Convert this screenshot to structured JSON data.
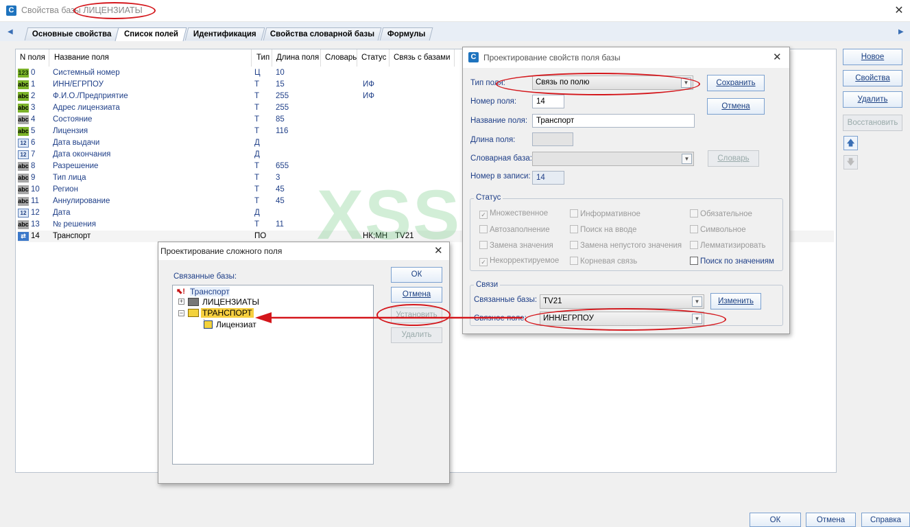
{
  "window": {
    "title": "Свойства базы ЛИЦЕНЗИАТЫ",
    "close": "✕"
  },
  "tabs": [
    {
      "label": "Основные свойства",
      "active": false
    },
    {
      "label": "Список полей",
      "active": true
    },
    {
      "label": "Идентификация",
      "active": false
    },
    {
      "label": "Свойства словарной базы",
      "active": false
    },
    {
      "label": "Формулы",
      "active": false
    }
  ],
  "table": {
    "headers": [
      "N поля",
      "Название поля",
      "Тип",
      "Длина поля",
      "Словарь",
      "Статус",
      "Связь с базами"
    ],
    "rows": [
      {
        "icon": "123",
        "num": "0",
        "name": "Системный номер",
        "type": "Ц",
        "len": "10",
        "status": "",
        "link": ""
      },
      {
        "icon": "abc",
        "num": "1",
        "name": "ИНН/ЕГРПОУ",
        "type": "Т",
        "len": "15",
        "status": "ИФ",
        "link": ""
      },
      {
        "icon": "abc",
        "num": "2",
        "name": "Ф.И.О./Предприятие",
        "type": "Т",
        "len": "255",
        "status": "ИФ",
        "link": ""
      },
      {
        "icon": "abc",
        "num": "3",
        "name": "Адрес лицензиата",
        "type": "Т",
        "len": "255",
        "status": "",
        "link": ""
      },
      {
        "icon": "abc",
        "num": "4",
        "name": "Состояние",
        "type": "Т",
        "len": "85",
        "status": "",
        "link": ""
      },
      {
        "icon": "abc",
        "num": "5",
        "name": "Лицензия",
        "type": "Т",
        "len": "116",
        "status": "",
        "link": ""
      },
      {
        "icon": "12",
        "num": "6",
        "name": "Дата выдачи",
        "type": "Д",
        "len": "",
        "status": "",
        "link": ""
      },
      {
        "icon": "12",
        "num": "7",
        "name": "Дата окончания",
        "type": "Д",
        "len": "",
        "status": "",
        "link": ""
      },
      {
        "icon": "abc",
        "num": "8",
        "name": "Разрешение",
        "type": "Т",
        "len": "655",
        "status": "",
        "link": ""
      },
      {
        "icon": "abc",
        "num": "9",
        "name": "Тип лица",
        "type": "Т",
        "len": "3",
        "status": "",
        "link": ""
      },
      {
        "icon": "abc",
        "num": "10",
        "name": "Регион",
        "type": "Т",
        "len": "45",
        "status": "",
        "link": ""
      },
      {
        "icon": "abc",
        "num": "11",
        "name": "Аннулирование",
        "type": "Т",
        "len": "45",
        "status": "",
        "link": ""
      },
      {
        "icon": "12",
        "num": "12",
        "name": "Дата",
        "type": "Д",
        "len": "",
        "status": "",
        "link": ""
      },
      {
        "icon": "abc",
        "num": "13",
        "name": "№ решения",
        "type": "Т",
        "len": "11",
        "status": "",
        "link": ""
      },
      {
        "icon": "⇄",
        "num": "14",
        "name": "Транспорт",
        "type": "ПО",
        "len": "",
        "status": "НК;МН",
        "link": "TV21"
      }
    ]
  },
  "side_buttons": {
    "new": "Новое",
    "props": "Свойства",
    "delete": "Удалить",
    "restore": "Восстановить",
    "up": "🡅",
    "down": "🡇"
  },
  "bottom_buttons": {
    "ok": "ОК",
    "cancel": "Отмена",
    "help": "Справка"
  },
  "watermark": "XSS.is",
  "field_dialog": {
    "title": "Проектирование свойств поля базы",
    "labels": {
      "type": "Тип поля:",
      "num": "Номер поля:",
      "name": "Название поля:",
      "len": "Длина поля:",
      "dict": "Словарная база:",
      "recnum": "Номер в записи:"
    },
    "values": {
      "type": "Связь по полю",
      "num": "14",
      "name": "Транспорт",
      "len": "",
      "dict": "",
      "recnum": "14"
    },
    "buttons": {
      "save": "Сохранить",
      "cancel": "Отмена",
      "dict": "Словарь",
      "change": "Изменить"
    },
    "status_title": "Статус",
    "checkboxes": [
      {
        "label": "Множественное",
        "checked": true,
        "enabled": false
      },
      {
        "label": "Автозаполнение",
        "checked": false,
        "enabled": false
      },
      {
        "label": "Замена значения",
        "checked": false,
        "enabled": false
      },
      {
        "label": "Некорректируемое",
        "checked": true,
        "enabled": false
      },
      {
        "label": "Информативное",
        "checked": false,
        "enabled": false
      },
      {
        "label": "Поиск на вводе",
        "checked": false,
        "enabled": false
      },
      {
        "label": "Замена непустого значения",
        "checked": false,
        "enabled": false
      },
      {
        "label": "Корневая связь",
        "checked": false,
        "enabled": false
      },
      {
        "label": "Обязательное",
        "checked": false,
        "enabled": false
      },
      {
        "label": "Символьное",
        "checked": false,
        "enabled": false
      },
      {
        "label": "Лемматизировать",
        "checked": false,
        "enabled": false
      },
      {
        "label": "Поиск по значениям",
        "checked": false,
        "enabled": true
      }
    ],
    "links_title": "Связи",
    "links_labels": {
      "bases": "Связанные базы:",
      "field": "Связное поле:"
    },
    "links_values": {
      "bases": "TV21",
      "field": "ИНН/ЕГРПОУ"
    }
  },
  "complex_dialog": {
    "title": "Проектирование сложного поля",
    "label": "Связанные базы:",
    "tree": {
      "root": "Транспорт",
      "n1": "ЛИЦЕНЗИАТЫ",
      "n2": "ТРАНСПОРТ",
      "n3": "Лицензиат"
    },
    "buttons": {
      "ok": "ОК",
      "cancel": "Отмена",
      "set": "Установить",
      "delete": "Удалить"
    }
  }
}
